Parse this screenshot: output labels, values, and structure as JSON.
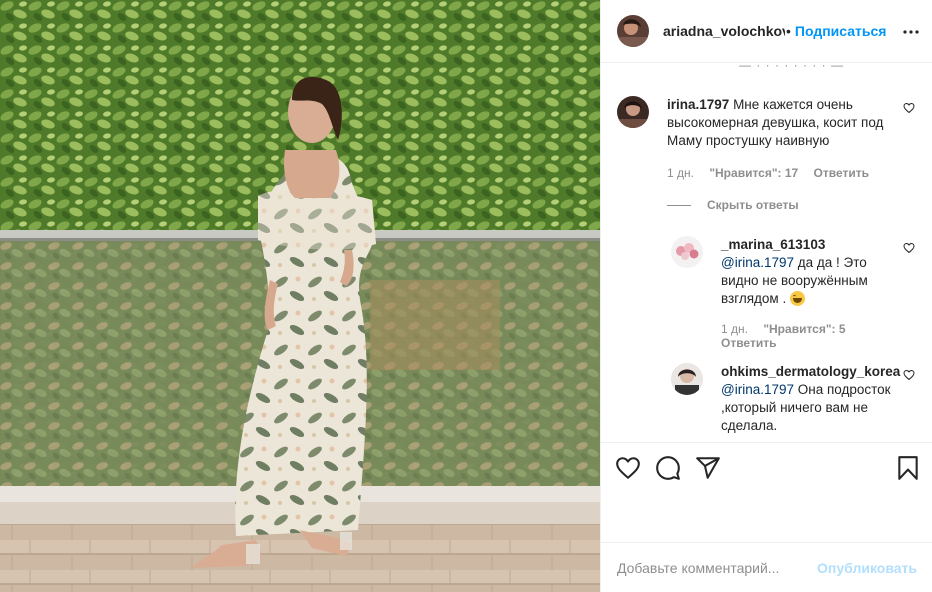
{
  "post": {
    "author": "ariadna_volochkova",
    "separator": "•",
    "follow_label": "Подписаться"
  },
  "comments": [
    {
      "user": "irina.1797",
      "text": "Мне кажется очень высокомерная девушка, косит под Маму простушку наивную",
      "time": "1 дн.",
      "likes": "\"Нравится\": 17",
      "reply_label": "Ответить",
      "hide_replies_label": "Скрыть ответы",
      "replies": [
        {
          "user": "_marina_613103",
          "mention": "@irina.1797",
          "text": "да да ! Это видно не вооружённым взглядом .",
          "time": "1 дн.",
          "likes": "\"Нравится\": 5",
          "reply_label": "Ответить"
        },
        {
          "user": "ohkims_dermatology_korea",
          "mention": "@irina.1797",
          "text": "Она подросток ,который ничего вам не сделала."
        }
      ]
    }
  ],
  "icons": {
    "more": "more-options-icon",
    "like": "heart-icon",
    "comment": "comment-icon",
    "share": "share-icon",
    "save": "bookmark-icon"
  },
  "add_comment": {
    "placeholder": "Добавьте комментарий...",
    "post_label": "Опубликовать"
  },
  "colors": {
    "accent": "#0095f6",
    "post_disabled": "#b2dffc",
    "muted": "#8e8e8e"
  }
}
